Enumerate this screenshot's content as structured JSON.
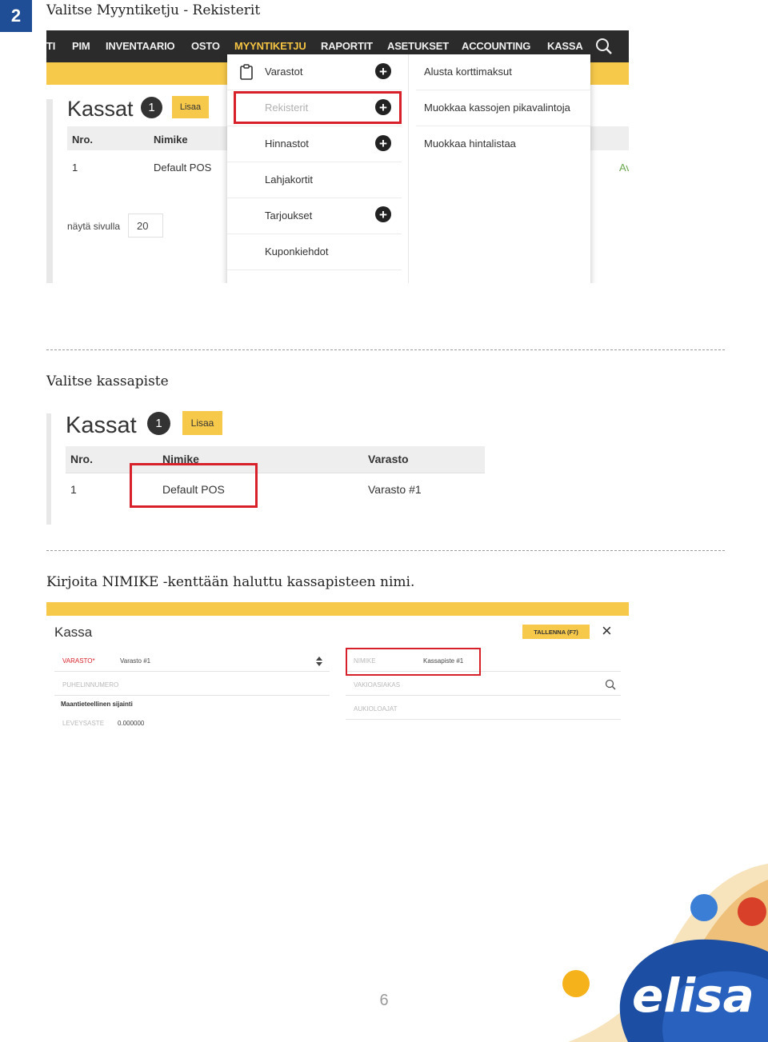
{
  "step": {
    "number": "2"
  },
  "sections": [
    {
      "heading": "Valitse Myyntiketju - Rekisterit"
    },
    {
      "heading": "Valitse kassapiste"
    },
    {
      "heading": "Kirjoita NIMIKE -kenttään haluttu kassapisteen nimi."
    }
  ],
  "shot1": {
    "nav": [
      "TI",
      "PIM",
      "INVENTAARIO",
      "OSTO",
      "MYYNTIKETJU",
      "RAPORTIT",
      "ASETUKSET",
      "ACCOUNTING",
      "KASSA"
    ],
    "active_nav": "MYYNTIKETJU",
    "title": "Kassat",
    "count": "1",
    "add_label": "Lisaa",
    "columns": [
      "Nro.",
      "Nimike"
    ],
    "row": {
      "nro": "1",
      "nimike": "Default POS"
    },
    "pagesize_label": "näytä sivulla",
    "pagesize_value": "20",
    "cut_text": "Av",
    "menu_left": [
      "Varastot",
      "Rekisterit",
      "Hinnastot",
      "Lahjakortit",
      "Tarjoukset",
      "Kuponkiehdot"
    ],
    "menu_right": [
      "Alusta korttimaksut",
      "Muokkaa kassojen pikavalintoja",
      "Muokkaa hintalistaa"
    ]
  },
  "shot2": {
    "title": "Kassat",
    "count": "1",
    "add_label": "Lisaa",
    "columns": [
      "Nro.",
      "Nimike",
      "Varasto"
    ],
    "row": {
      "nro": "1",
      "nimike": "Default POS",
      "varasto": "Varasto #1"
    }
  },
  "shot3": {
    "title": "Kassa",
    "save_label": "TALLENNA (F7)",
    "close_icon": "×",
    "fields": {
      "varasto_label": "VARASTO*",
      "varasto_value": "Varasto #1",
      "puhelin_label": "PUHELINNUMERO",
      "location_heading": "Maantieteellinen sijainti",
      "leveysaste_label": "LEVEYSASTE",
      "leveysaste_value": "0.000000",
      "nimike_label": "NIMIKE",
      "nimike_value": "Kassapiste #1",
      "vakioasiakas_label": "VAKIOASIAKAS",
      "aukiolo_label": "AUKIOLOAJAT"
    }
  },
  "page_number": "6",
  "brand": {
    "logo_text": "elisa",
    "color_primary": "#1f4e96",
    "accent": "#f7c94a",
    "highlight": "#d8202a"
  }
}
